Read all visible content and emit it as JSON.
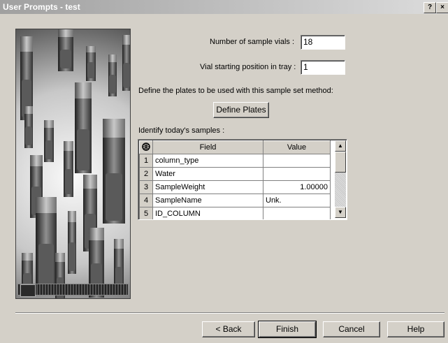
{
  "window": {
    "title": "User Prompts - test",
    "help_glyph": "?",
    "close_glyph": "×"
  },
  "form": {
    "num_vials_label": "Number of sample vials :",
    "num_vials_value": "18",
    "start_pos_label": "Vial starting position in tray :",
    "start_pos_value": "1",
    "plates_prompt": "Define the plates to be used with this sample set method:",
    "define_plates_button": "Define Plates",
    "identify_label": "Identify today's samples :"
  },
  "grid": {
    "corner_icon": "globe-icon",
    "columns": [
      "Field",
      "Value"
    ],
    "rows": [
      {
        "num": "1",
        "field": "column_type",
        "value": ""
      },
      {
        "num": "2",
        "field": "Water",
        "value": ""
      },
      {
        "num": "3",
        "field": "SampleWeight",
        "value": "1.00000"
      },
      {
        "num": "4",
        "field": "SampleName",
        "value": "Unk."
      },
      {
        "num": "5",
        "field": "ID_COLUMN",
        "value": ""
      }
    ]
  },
  "buttons": {
    "back": "< Back",
    "finish": "Finish",
    "cancel": "Cancel",
    "help": "Help"
  },
  "colors": {
    "dialog_bg": "#d4d0c8",
    "titlebar_start": "#a0a0a0"
  }
}
